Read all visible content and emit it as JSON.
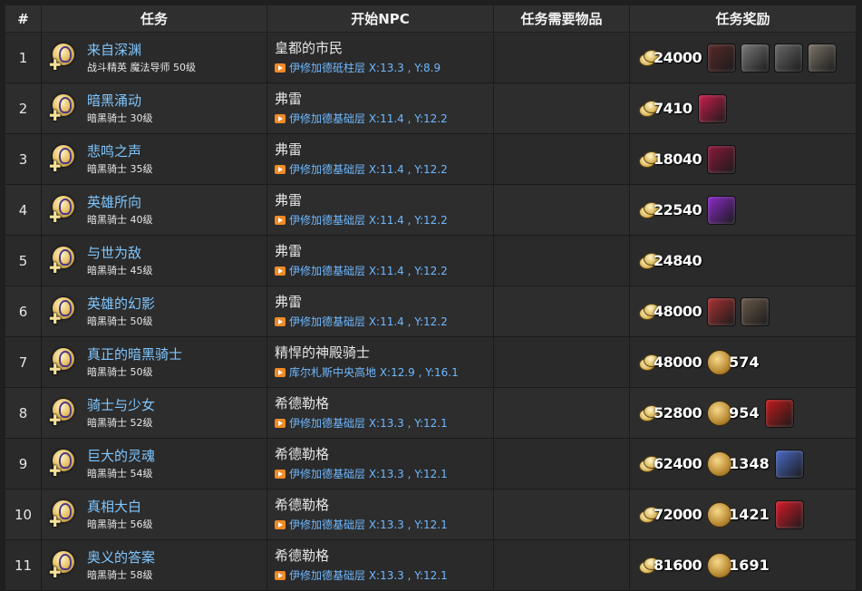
{
  "headers": {
    "num": "#",
    "quest": "任务",
    "npc": "开始NPC",
    "items": "任务需要物品",
    "reward": "任务奖励"
  },
  "rows": [
    {
      "num": "1",
      "quest": "来自深渊",
      "sub": "战斗精英 魔法导师 50级",
      "npc": "皇都的市民",
      "loc": "伊修加德砥柱层 X:13.3 , Y:8.9",
      "gil": "24000",
      "token": "",
      "items": [
        "#5a2a2a",
        "#7a7a7a",
        "#6a6a6a",
        "#7c7468"
      ]
    },
    {
      "num": "2",
      "quest": "暗黑涌动",
      "sub": "暗黑骑士 30级",
      "npc": "弗雷",
      "loc": "伊修加德基础层 X:11.4 , Y:12.2",
      "gil": "7410",
      "token": "",
      "items": [
        "#c81e4a"
      ]
    },
    {
      "num": "3",
      "quest": "悲鸣之声",
      "sub": "暗黑骑士 35级",
      "npc": "弗雷",
      "loc": "伊修加德基础层 X:11.4 , Y:12.2",
      "gil": "18040",
      "token": "",
      "items": [
        "#8a1a3a"
      ]
    },
    {
      "num": "4",
      "quest": "英雄所向",
      "sub": "暗黑骑士 40级",
      "npc": "弗雷",
      "loc": "伊修加德基础层 X:11.4 , Y:12.2",
      "gil": "22540",
      "token": "",
      "items": [
        "#8a2ac8"
      ]
    },
    {
      "num": "5",
      "quest": "与世为敌",
      "sub": "暗黑骑士 45级",
      "npc": "弗雷",
      "loc": "伊修加德基础层 X:11.4 , Y:12.2",
      "gil": "24840",
      "token": "",
      "items": []
    },
    {
      "num": "6",
      "quest": "英雄的幻影",
      "sub": "暗黑骑士 50级",
      "npc": "弗雷",
      "loc": "伊修加德基础层 X:11.4 , Y:12.2",
      "gil": "48000",
      "token": "",
      "items": [
        "#a83232",
        "#6a5a4a"
      ]
    },
    {
      "num": "7",
      "quest": "真正的暗黑骑士",
      "sub": "暗黑骑士 50级",
      "npc": "精悍的神殿骑士",
      "loc": "库尔札斯中央高地 X:12.9 , Y:16.1",
      "gil": "48000",
      "token": "574",
      "items": []
    },
    {
      "num": "8",
      "quest": "骑士与少女",
      "sub": "暗黑骑士 52级",
      "npc": "希德勒格",
      "loc": "伊修加德基础层 X:13.3 , Y:12.1",
      "gil": "52800",
      "token": "954",
      "items": [
        "#c21a1a"
      ]
    },
    {
      "num": "9",
      "quest": "巨大的灵魂",
      "sub": "暗黑骑士 54级",
      "npc": "希德勒格",
      "loc": "伊修加德基础层 X:13.3 , Y:12.1",
      "gil": "62400",
      "token": "1348",
      "items": [
        "#4a6ac8"
      ]
    },
    {
      "num": "10",
      "quest": "真相大白",
      "sub": "暗黑骑士 56级",
      "npc": "希德勒格",
      "loc": "伊修加德基础层 X:13.3 , Y:12.1",
      "gil": "72000",
      "token": "1421",
      "items": [
        "#d81a2a"
      ]
    },
    {
      "num": "11",
      "quest": "奥义的答案",
      "sub": "暗黑骑士 58级",
      "npc": "希德勒格",
      "loc": "伊修加德基础层 X:13.3 , Y:12.1",
      "gil": "81600",
      "token": "1691",
      "items": []
    }
  ]
}
